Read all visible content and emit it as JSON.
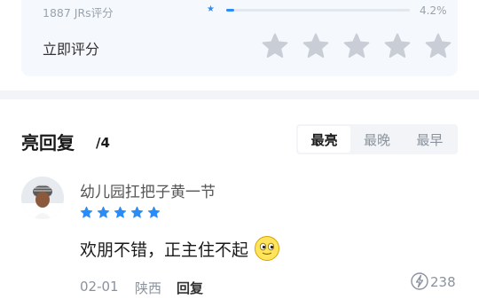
{
  "rating": {
    "count_text": "1887 JRs评分",
    "distribution": {
      "percent_text": "4.2%",
      "fraction": 0.042
    },
    "rate_now_label": "立即评分",
    "rate_stars_color": "#c9ced6"
  },
  "replies": {
    "title": "亮回复",
    "count": "/4",
    "sort_tabs": [
      "最亮",
      "最晚",
      "最早"
    ],
    "active_tab": "最亮",
    "items": [
      {
        "username": "幼儿园扛把子黄一节",
        "stars": 5,
        "content": "欢朋不错，正主住不起",
        "emoji": "smile-emoji",
        "date": "02-01",
        "location": "陕西",
        "reply_label": "回复",
        "light_count": "238"
      }
    ]
  },
  "colors": {
    "accent": "#2b8cf7",
    "muted": "#8a939d"
  }
}
